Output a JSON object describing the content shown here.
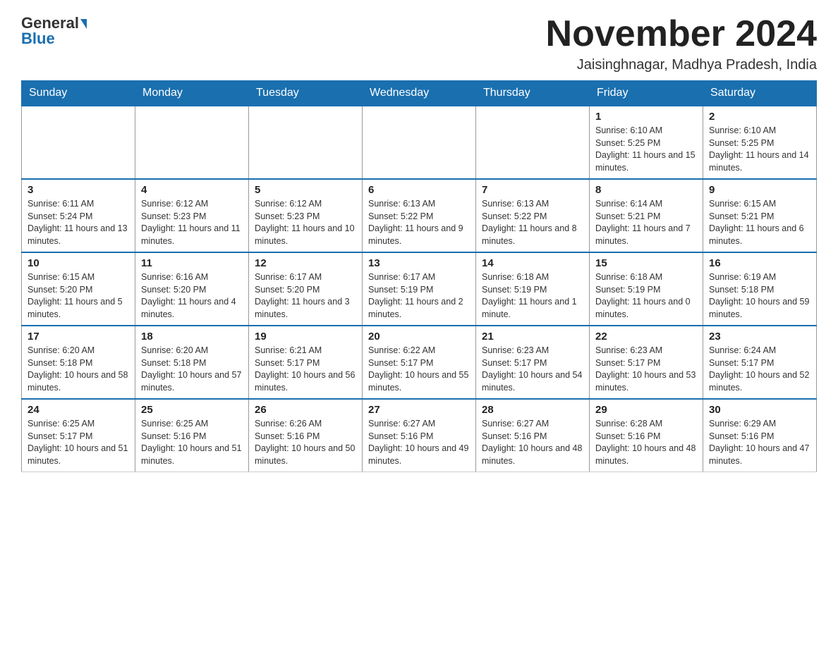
{
  "header": {
    "logo_general": "General",
    "logo_blue": "Blue",
    "month_title": "November 2024",
    "location": "Jaisinghnagar, Madhya Pradesh, India"
  },
  "days_of_week": [
    "Sunday",
    "Monday",
    "Tuesday",
    "Wednesday",
    "Thursday",
    "Friday",
    "Saturday"
  ],
  "weeks": [
    [
      {
        "day": "",
        "info": ""
      },
      {
        "day": "",
        "info": ""
      },
      {
        "day": "",
        "info": ""
      },
      {
        "day": "",
        "info": ""
      },
      {
        "day": "",
        "info": ""
      },
      {
        "day": "1",
        "info": "Sunrise: 6:10 AM\nSunset: 5:25 PM\nDaylight: 11 hours and 15 minutes."
      },
      {
        "day": "2",
        "info": "Sunrise: 6:10 AM\nSunset: 5:25 PM\nDaylight: 11 hours and 14 minutes."
      }
    ],
    [
      {
        "day": "3",
        "info": "Sunrise: 6:11 AM\nSunset: 5:24 PM\nDaylight: 11 hours and 13 minutes."
      },
      {
        "day": "4",
        "info": "Sunrise: 6:12 AM\nSunset: 5:23 PM\nDaylight: 11 hours and 11 minutes."
      },
      {
        "day": "5",
        "info": "Sunrise: 6:12 AM\nSunset: 5:23 PM\nDaylight: 11 hours and 10 minutes."
      },
      {
        "day": "6",
        "info": "Sunrise: 6:13 AM\nSunset: 5:22 PM\nDaylight: 11 hours and 9 minutes."
      },
      {
        "day": "7",
        "info": "Sunrise: 6:13 AM\nSunset: 5:22 PM\nDaylight: 11 hours and 8 minutes."
      },
      {
        "day": "8",
        "info": "Sunrise: 6:14 AM\nSunset: 5:21 PM\nDaylight: 11 hours and 7 minutes."
      },
      {
        "day": "9",
        "info": "Sunrise: 6:15 AM\nSunset: 5:21 PM\nDaylight: 11 hours and 6 minutes."
      }
    ],
    [
      {
        "day": "10",
        "info": "Sunrise: 6:15 AM\nSunset: 5:20 PM\nDaylight: 11 hours and 5 minutes."
      },
      {
        "day": "11",
        "info": "Sunrise: 6:16 AM\nSunset: 5:20 PM\nDaylight: 11 hours and 4 minutes."
      },
      {
        "day": "12",
        "info": "Sunrise: 6:17 AM\nSunset: 5:20 PM\nDaylight: 11 hours and 3 minutes."
      },
      {
        "day": "13",
        "info": "Sunrise: 6:17 AM\nSunset: 5:19 PM\nDaylight: 11 hours and 2 minutes."
      },
      {
        "day": "14",
        "info": "Sunrise: 6:18 AM\nSunset: 5:19 PM\nDaylight: 11 hours and 1 minute."
      },
      {
        "day": "15",
        "info": "Sunrise: 6:18 AM\nSunset: 5:19 PM\nDaylight: 11 hours and 0 minutes."
      },
      {
        "day": "16",
        "info": "Sunrise: 6:19 AM\nSunset: 5:18 PM\nDaylight: 10 hours and 59 minutes."
      }
    ],
    [
      {
        "day": "17",
        "info": "Sunrise: 6:20 AM\nSunset: 5:18 PM\nDaylight: 10 hours and 58 minutes."
      },
      {
        "day": "18",
        "info": "Sunrise: 6:20 AM\nSunset: 5:18 PM\nDaylight: 10 hours and 57 minutes."
      },
      {
        "day": "19",
        "info": "Sunrise: 6:21 AM\nSunset: 5:17 PM\nDaylight: 10 hours and 56 minutes."
      },
      {
        "day": "20",
        "info": "Sunrise: 6:22 AM\nSunset: 5:17 PM\nDaylight: 10 hours and 55 minutes."
      },
      {
        "day": "21",
        "info": "Sunrise: 6:23 AM\nSunset: 5:17 PM\nDaylight: 10 hours and 54 minutes."
      },
      {
        "day": "22",
        "info": "Sunrise: 6:23 AM\nSunset: 5:17 PM\nDaylight: 10 hours and 53 minutes."
      },
      {
        "day": "23",
        "info": "Sunrise: 6:24 AM\nSunset: 5:17 PM\nDaylight: 10 hours and 52 minutes."
      }
    ],
    [
      {
        "day": "24",
        "info": "Sunrise: 6:25 AM\nSunset: 5:17 PM\nDaylight: 10 hours and 51 minutes."
      },
      {
        "day": "25",
        "info": "Sunrise: 6:25 AM\nSunset: 5:16 PM\nDaylight: 10 hours and 51 minutes."
      },
      {
        "day": "26",
        "info": "Sunrise: 6:26 AM\nSunset: 5:16 PM\nDaylight: 10 hours and 50 minutes."
      },
      {
        "day": "27",
        "info": "Sunrise: 6:27 AM\nSunset: 5:16 PM\nDaylight: 10 hours and 49 minutes."
      },
      {
        "day": "28",
        "info": "Sunrise: 6:27 AM\nSunset: 5:16 PM\nDaylight: 10 hours and 48 minutes."
      },
      {
        "day": "29",
        "info": "Sunrise: 6:28 AM\nSunset: 5:16 PM\nDaylight: 10 hours and 48 minutes."
      },
      {
        "day": "30",
        "info": "Sunrise: 6:29 AM\nSunset: 5:16 PM\nDaylight: 10 hours and 47 minutes."
      }
    ]
  ]
}
